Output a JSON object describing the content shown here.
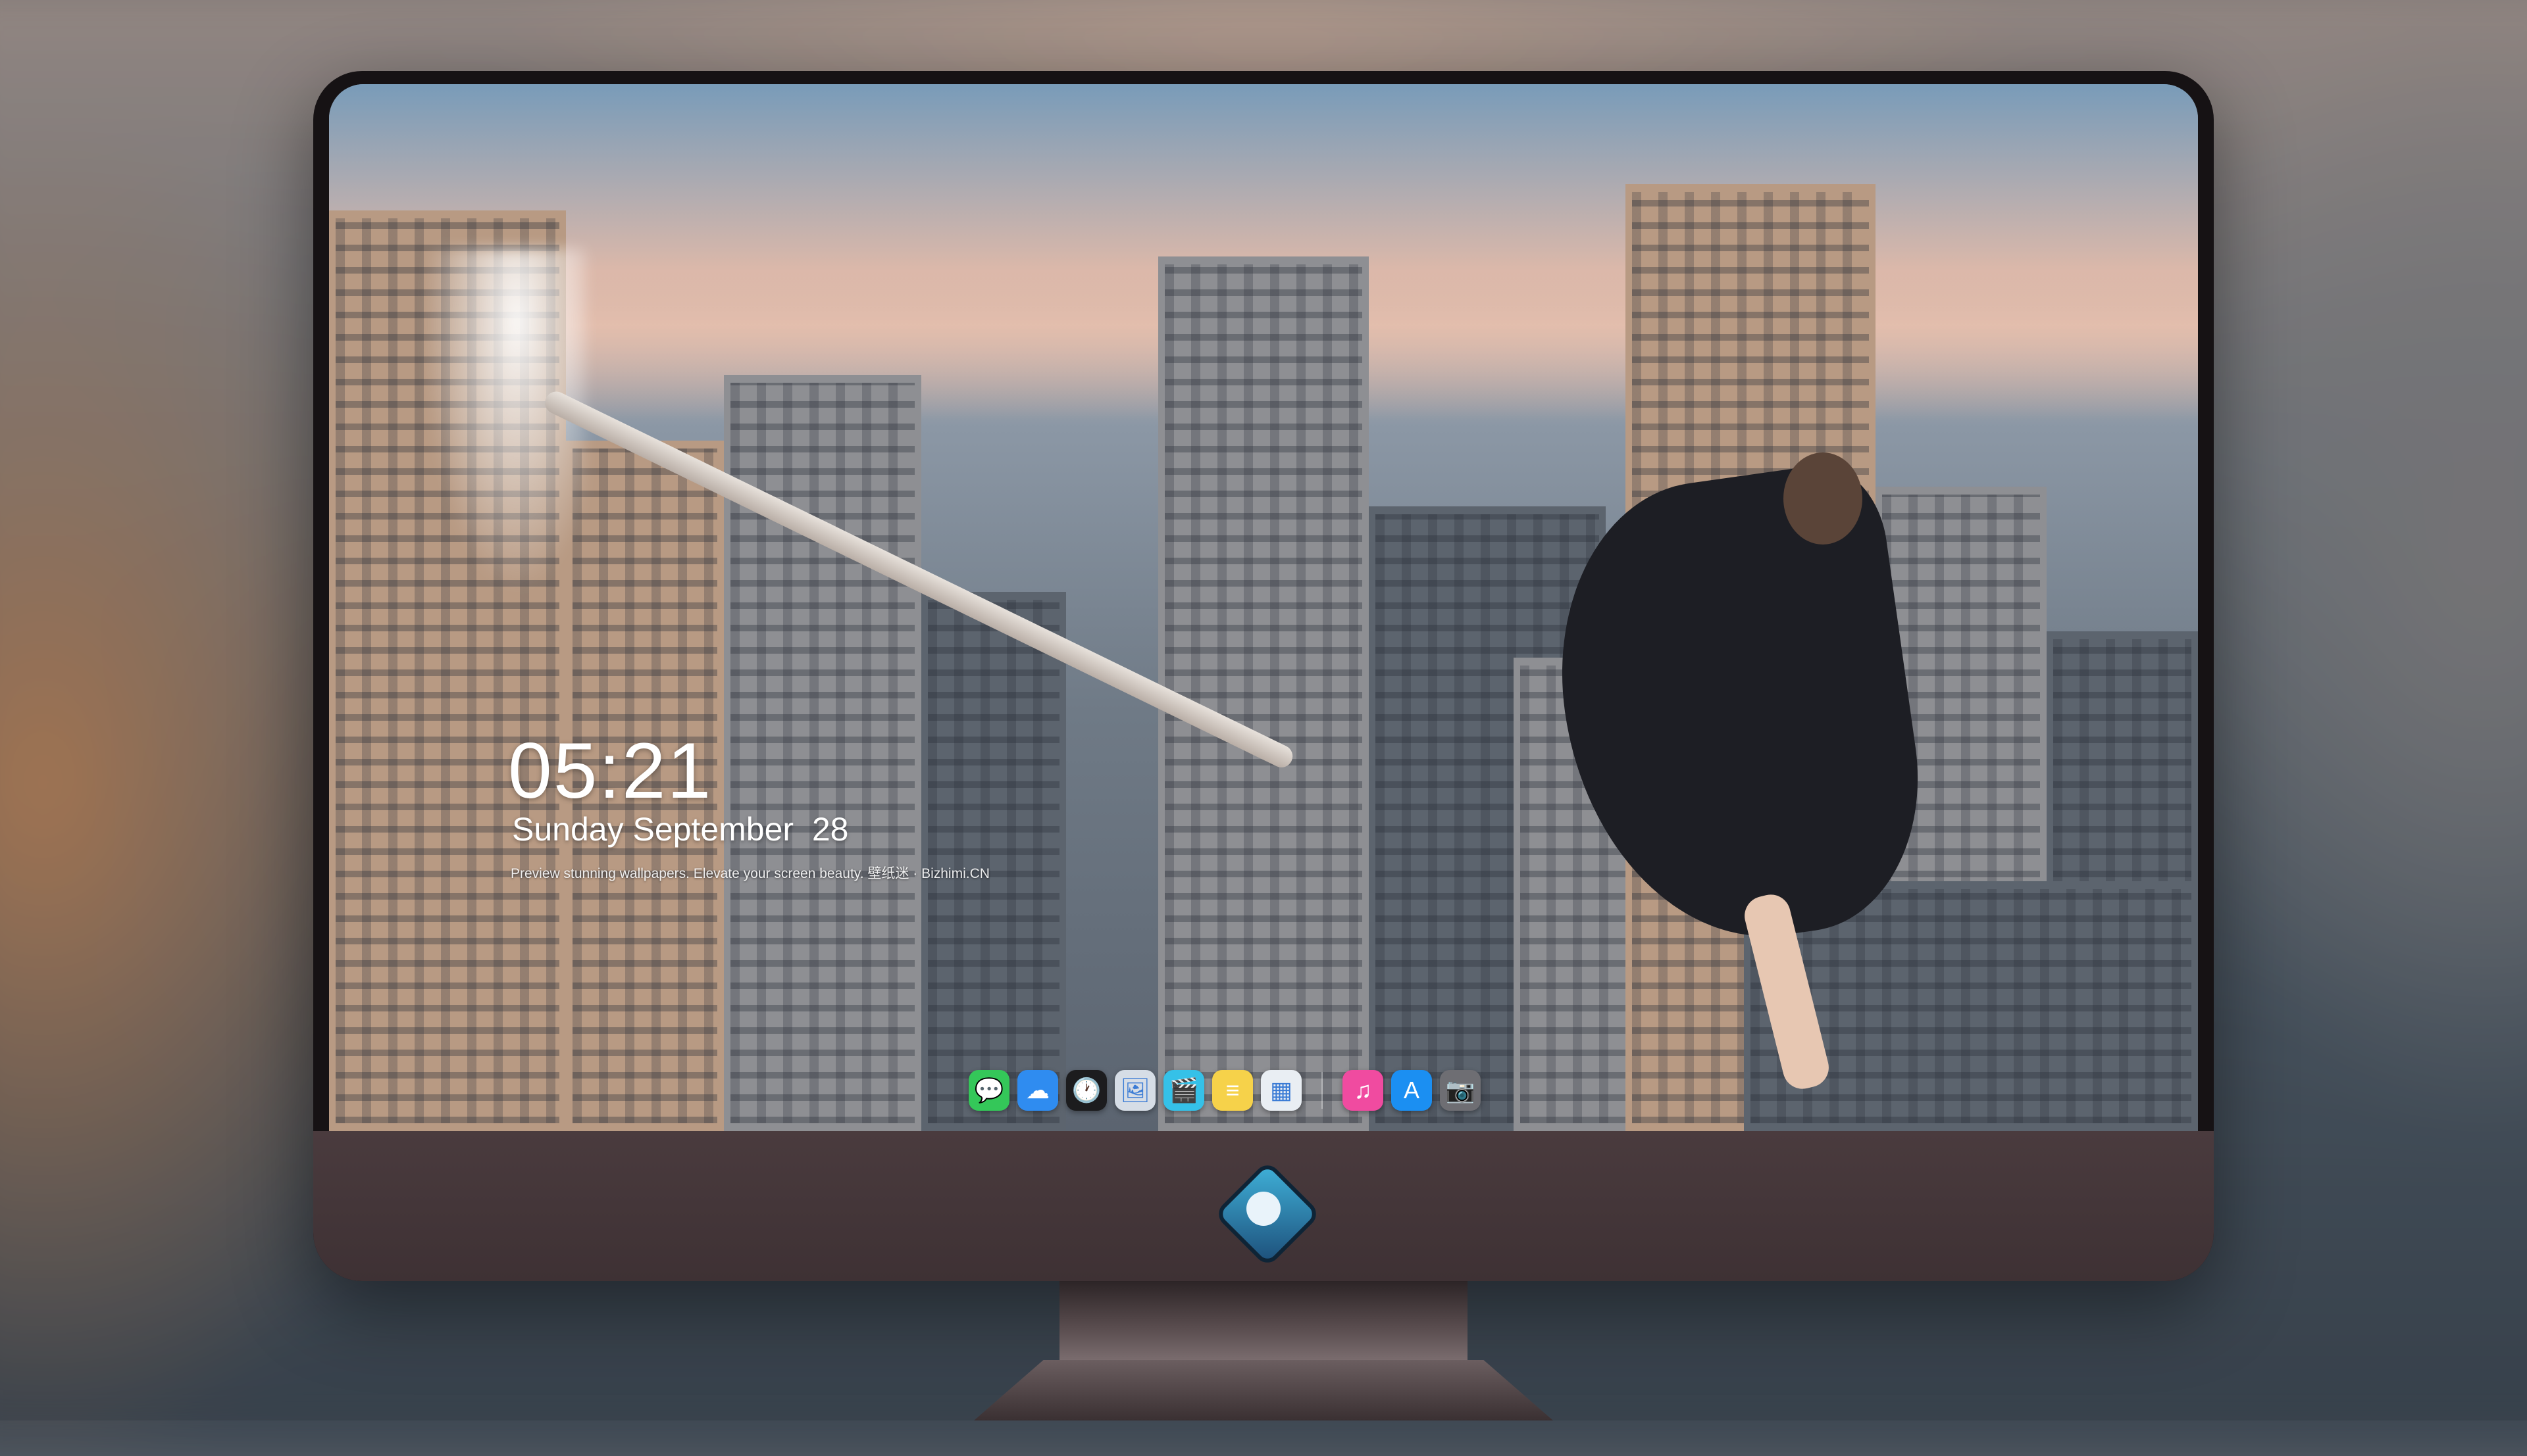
{
  "lockscreen": {
    "time": "05:21",
    "date": "Sunday September  28",
    "tagline": "Preview stunning wallpapers. Elevate your screen beauty. 壁纸迷 · Bizhimi.CN"
  },
  "dock": {
    "apps": [
      {
        "name": "Messages",
        "icon": "messages-icon",
        "glyph": "💬",
        "color": "#34c759"
      },
      {
        "name": "Weather",
        "icon": "weather-icon",
        "glyph": "☁",
        "color": "#2f8cf0"
      },
      {
        "name": "Clock",
        "icon": "clock-icon",
        "glyph": "🕐",
        "color": "#1c1c1e"
      },
      {
        "name": "Preview",
        "icon": "preview-icon",
        "glyph": "🖼",
        "color": "#d6dde6"
      },
      {
        "name": "Clips",
        "icon": "clips-icon",
        "glyph": "🎬",
        "color": "#35c1e8"
      },
      {
        "name": "Notes",
        "icon": "notes-icon",
        "glyph": "≡",
        "color": "#f6d24a"
      },
      {
        "name": "Photos",
        "icon": "photos-icon",
        "glyph": "▦",
        "color": "#e9eef3"
      },
      {
        "name": "Music",
        "icon": "music-icon",
        "glyph": "♫",
        "color": "#f04ba0"
      },
      {
        "name": "App Store",
        "icon": "app-store-icon",
        "glyph": "A",
        "color": "#1b8ff2"
      },
      {
        "name": "Camera",
        "icon": "camera-icon",
        "glyph": "📷",
        "color": "#6e6e73"
      }
    ]
  },
  "brand": {
    "logo": "bizhimi-logo-icon"
  }
}
